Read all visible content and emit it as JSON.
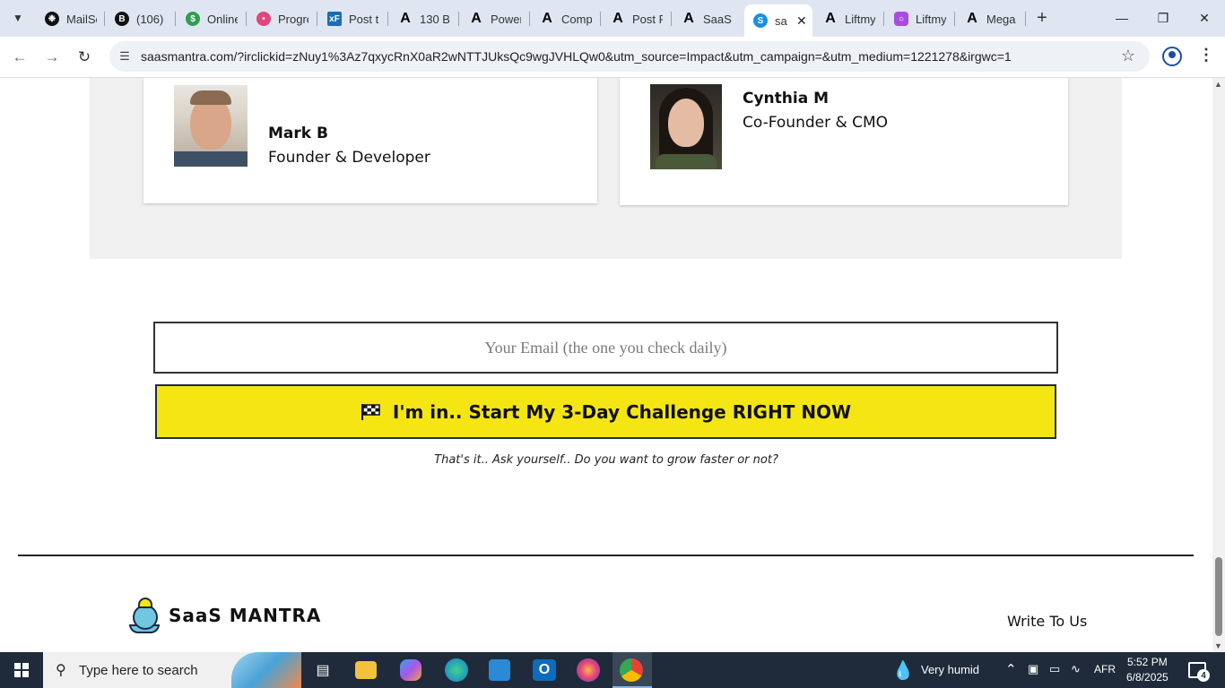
{
  "browser": {
    "tabs": [
      {
        "title": "MailSc",
        "icon": "openai-icon",
        "color": "#111111"
      },
      {
        "title": "(106)",
        "icon": "bold-b-icon",
        "color": "#111111"
      },
      {
        "title": "Online",
        "icon": "dollar-icon",
        "color": "#2e9e50"
      },
      {
        "title": "Progre",
        "icon": "dots-icon",
        "color": "#e0457b"
      },
      {
        "title": "Post t",
        "icon": "xf-icon",
        "color": "#1a6cb5"
      },
      {
        "title": "130 B",
        "icon": "a-icon",
        "color": "#000000"
      },
      {
        "title": "Power",
        "icon": "a-icon",
        "color": "#000000"
      },
      {
        "title": "Comp",
        "icon": "a-icon",
        "color": "#000000"
      },
      {
        "title": "Post P",
        "icon": "a-icon",
        "color": "#000000"
      },
      {
        "title": "SaaS M",
        "icon": "a-icon",
        "color": "#000000"
      },
      {
        "title": "sa",
        "icon": "s-icon",
        "color": "#1a8fe3",
        "active": true
      },
      {
        "title": "Liftmy",
        "icon": "a-icon",
        "color": "#000000"
      },
      {
        "title": "Liftmy",
        "icon": "liftmy-icon",
        "color": "#a84de0"
      },
      {
        "title": "Mega",
        "icon": "a-icon",
        "color": "#000000"
      }
    ],
    "url": "saasmantra.com/?irclickid=zNuy1%3Az7qxycRnX0aR2wNTTJUksQc9wgJVHLQw0&utm_source=Impact&utm_campaign=&utm_medium=1221278&irgwc=1"
  },
  "team": {
    "members": [
      {
        "name": "Mark B",
        "role": "Founder & Developer"
      },
      {
        "name": "Cynthia M",
        "role": "Co-Founder & CMO"
      }
    ]
  },
  "signup": {
    "email_placeholder": "Your Email (the one you check daily)",
    "email_value": "",
    "cta_label": "I'm in.. Start My 3-Day Challenge RIGHT NOW",
    "note": "That's it.. Ask yourself.. Do you want to grow faster or not?",
    "accent": "#f5e512"
  },
  "footer": {
    "logo_text": "SaaS MANTRA",
    "write_link": "Write To Us"
  },
  "taskbar": {
    "search_placeholder": "Type here to search",
    "weather": "Very humid",
    "language": "AFR",
    "time": "5:52 PM",
    "date": "6/8/2025",
    "notification_count": "4"
  }
}
